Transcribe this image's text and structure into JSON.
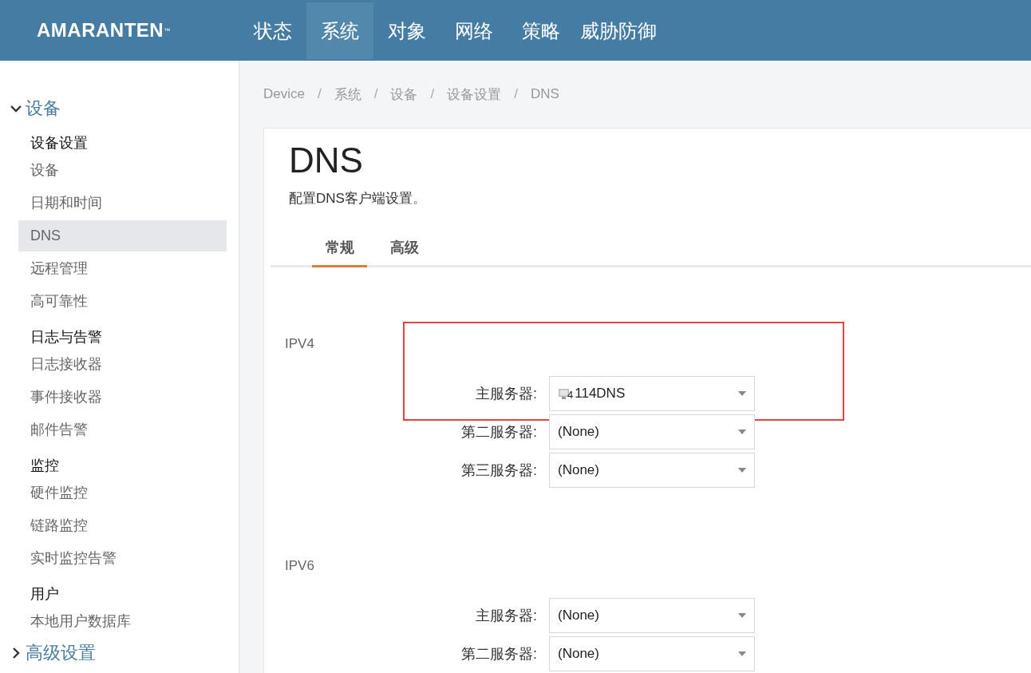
{
  "header": {
    "logo": "AMARANTEN$^{™}$",
    "nav": [
      {
        "label": "状态",
        "selected": false
      },
      {
        "label": "系统",
        "selected": true
      },
      {
        "label": "对象",
        "selected": false
      },
      {
        "label": "网络",
        "selected": false
      },
      {
        "label": "策略",
        "selected": false
      },
      {
        "label": "威胁防御",
        "selected": false
      }
    ]
  },
  "sidebar": {
    "groups": [
      {
        "label": "设备",
        "expanded": true,
        "sections": [
          {
            "title": "设备设置",
            "items": [
              {
                "label": "设备",
                "selected": false
              },
              {
                "label": "日期和时间",
                "selected": false
              },
              {
                "label": "DNS",
                "selected": true
              },
              {
                "label": "远程管理",
                "selected": false
              },
              {
                "label": "高可靠性",
                "selected": false
              }
            ]
          },
          {
            "title": "日志与告警",
            "items": [
              {
                "label": "日志接收器",
                "selected": false
              },
              {
                "label": "事件接收器",
                "selected": false
              },
              {
                "label": "邮件告警",
                "selected": false
              }
            ]
          },
          {
            "title": "监控",
            "items": [
              {
                "label": "硬件监控",
                "selected": false
              },
              {
                "label": "链路监控",
                "selected": false
              },
              {
                "label": "实时监控告警",
                "selected": false
              }
            ]
          },
          {
            "title": "用户",
            "items": [
              {
                "label": "本地用户数据库",
                "selected": false
              }
            ]
          }
        ]
      },
      {
        "label": "高级设置",
        "expanded": false
      }
    ]
  },
  "breadcrumbs": [
    {
      "label": "Device"
    },
    {
      "separator": "/",
      "label": "系统"
    },
    {
      "separator": "/",
      "label": "设备"
    },
    {
      "separator": "/",
      "label": "设备设置"
    },
    {
      "separator": "/",
      "label": "DNS"
    }
  ],
  "page": {
    "title": "DNS",
    "subtitle": "配置DNS客户端设置。",
    "tabs": [
      {
        "label": "常规",
        "selected": true
      },
      {
        "label": "高级",
        "selected": false
      }
    ],
    "sections": [
      {
        "title": "IPV4",
        "fields": [
          {
            "label": "主服务器:",
            "value": "114DNS",
            "icon_badge": "4",
            "highlighted": true
          },
          {
            "label": "第二服务器:",
            "value": "(None)",
            "highlighted": false
          },
          {
            "label": "第三服务器:",
            "value": "(None)",
            "highlighted": false
          }
        ]
      },
      {
        "title": "IPV6",
        "fields": [
          {
            "label": "主服务器:",
            "value": "(None)",
            "highlighted": false
          },
          {
            "label": "第二服务器:",
            "value": "(None)",
            "highlighted": false
          }
        ]
      }
    ]
  }
}
